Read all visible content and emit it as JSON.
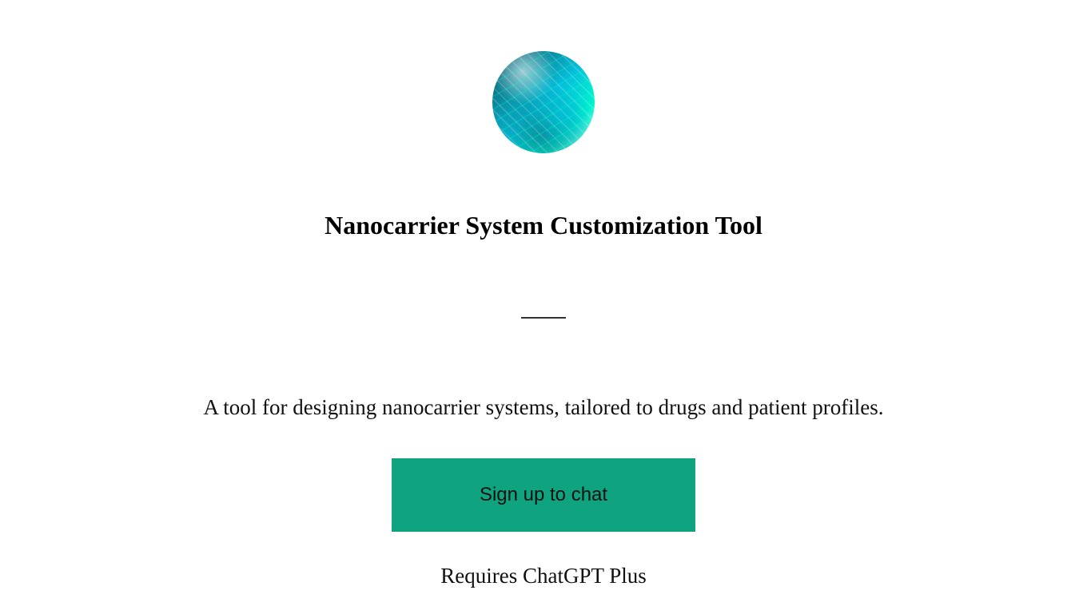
{
  "icon_name": "nanocarrier-avatar",
  "title": "Nanocarrier System Customization Tool",
  "description": "A tool for designing nanocarrier systems, tailored to drugs and patient profiles.",
  "button_label": "Sign up to chat",
  "requires_text": "Requires ChatGPT Plus",
  "accent_color": "#10a37f"
}
